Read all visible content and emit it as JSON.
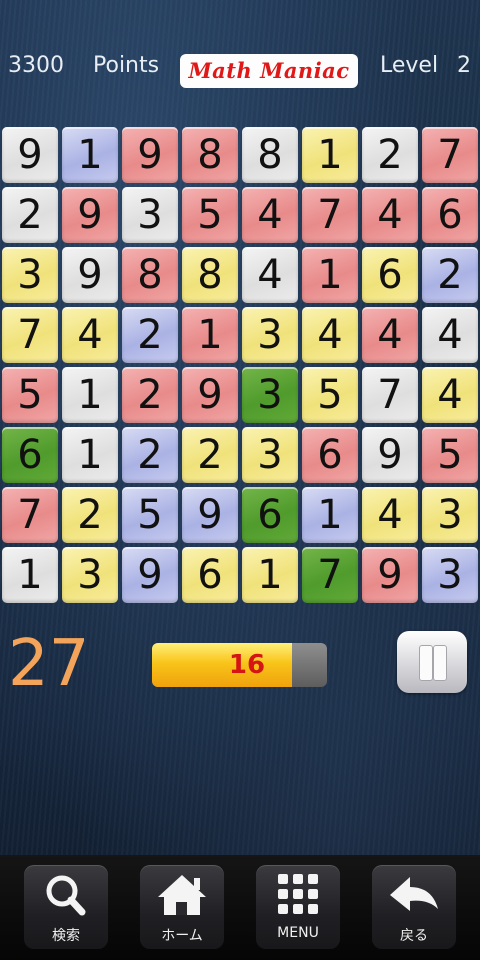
{
  "header": {
    "score": "3300",
    "points_label": "Points",
    "logo_text": "Math Maniac",
    "level_label": "Level",
    "level_value": "2"
  },
  "board": {
    "rows": [
      [
        {
          "n": "9",
          "c": "white"
        },
        {
          "n": "1",
          "c": "blue"
        },
        {
          "n": "9",
          "c": "red"
        },
        {
          "n": "8",
          "c": "red"
        },
        {
          "n": "8",
          "c": "white"
        },
        {
          "n": "1",
          "c": "yellow"
        },
        {
          "n": "2",
          "c": "white"
        },
        {
          "n": "7",
          "c": "red"
        }
      ],
      [
        {
          "n": "2",
          "c": "white"
        },
        {
          "n": "9",
          "c": "red"
        },
        {
          "n": "3",
          "c": "white"
        },
        {
          "n": "5",
          "c": "red"
        },
        {
          "n": "4",
          "c": "red"
        },
        {
          "n": "7",
          "c": "red"
        },
        {
          "n": "4",
          "c": "red"
        },
        {
          "n": "6",
          "c": "red"
        }
      ],
      [
        {
          "n": "3",
          "c": "yellow"
        },
        {
          "n": "9",
          "c": "white"
        },
        {
          "n": "8",
          "c": "red"
        },
        {
          "n": "8",
          "c": "yellow"
        },
        {
          "n": "4",
          "c": "white"
        },
        {
          "n": "1",
          "c": "red"
        },
        {
          "n": "6",
          "c": "yellow"
        },
        {
          "n": "2",
          "c": "blue"
        }
      ],
      [
        {
          "n": "7",
          "c": "yellow"
        },
        {
          "n": "4",
          "c": "yellow"
        },
        {
          "n": "2",
          "c": "blue"
        },
        {
          "n": "1",
          "c": "red"
        },
        {
          "n": "3",
          "c": "yellow"
        },
        {
          "n": "4",
          "c": "yellow"
        },
        {
          "n": "4",
          "c": "red"
        },
        {
          "n": "4",
          "c": "white"
        }
      ],
      [
        {
          "n": "5",
          "c": "red"
        },
        {
          "n": "1",
          "c": "white"
        },
        {
          "n": "2",
          "c": "red"
        },
        {
          "n": "9",
          "c": "red"
        },
        {
          "n": "3",
          "c": "green"
        },
        {
          "n": "5",
          "c": "yellow"
        },
        {
          "n": "7",
          "c": "white"
        },
        {
          "n": "4",
          "c": "yellow"
        }
      ],
      [
        {
          "n": "6",
          "c": "green"
        },
        {
          "n": "1",
          "c": "white"
        },
        {
          "n": "2",
          "c": "blue"
        },
        {
          "n": "2",
          "c": "yellow"
        },
        {
          "n": "3",
          "c": "yellow"
        },
        {
          "n": "6",
          "c": "red"
        },
        {
          "n": "9",
          "c": "white"
        },
        {
          "n": "5",
          "c": "red"
        }
      ],
      [
        {
          "n": "7",
          "c": "red"
        },
        {
          "n": "2",
          "c": "yellow"
        },
        {
          "n": "5",
          "c": "blue"
        },
        {
          "n": "9",
          "c": "blue"
        },
        {
          "n": "6",
          "c": "green"
        },
        {
          "n": "1",
          "c": "blue"
        },
        {
          "n": "4",
          "c": "yellow"
        },
        {
          "n": "3",
          "c": "yellow"
        }
      ],
      [
        {
          "n": "1",
          "c": "white"
        },
        {
          "n": "3",
          "c": "yellow"
        },
        {
          "n": "9",
          "c": "blue"
        },
        {
          "n": "6",
          "c": "yellow"
        },
        {
          "n": "1",
          "c": "yellow"
        },
        {
          "n": "7",
          "c": "green"
        },
        {
          "n": "9",
          "c": "red"
        },
        {
          "n": "3",
          "c": "blue"
        }
      ]
    ]
  },
  "status": {
    "timer": "27",
    "target_value": "16",
    "progress_fraction": 0.8
  },
  "pause": {
    "icon": "pause-icon"
  },
  "nav": {
    "items": [
      {
        "label": "検索",
        "icon": "search-icon"
      },
      {
        "label": "ホーム",
        "icon": "home-icon"
      },
      {
        "label": "MENU",
        "icon": "grid-menu-icon"
      },
      {
        "label": "戻る",
        "icon": "back-arrow-icon"
      }
    ]
  },
  "colors": {
    "tile_white": "#e6e6e6",
    "tile_blue": "#b4bbe8",
    "tile_red": "#ec9393",
    "tile_yellow": "#f3e68a",
    "tile_green": "#58a233",
    "timer": "#f3a45a",
    "target_text": "#d51414",
    "logo_text": "#e01818"
  }
}
